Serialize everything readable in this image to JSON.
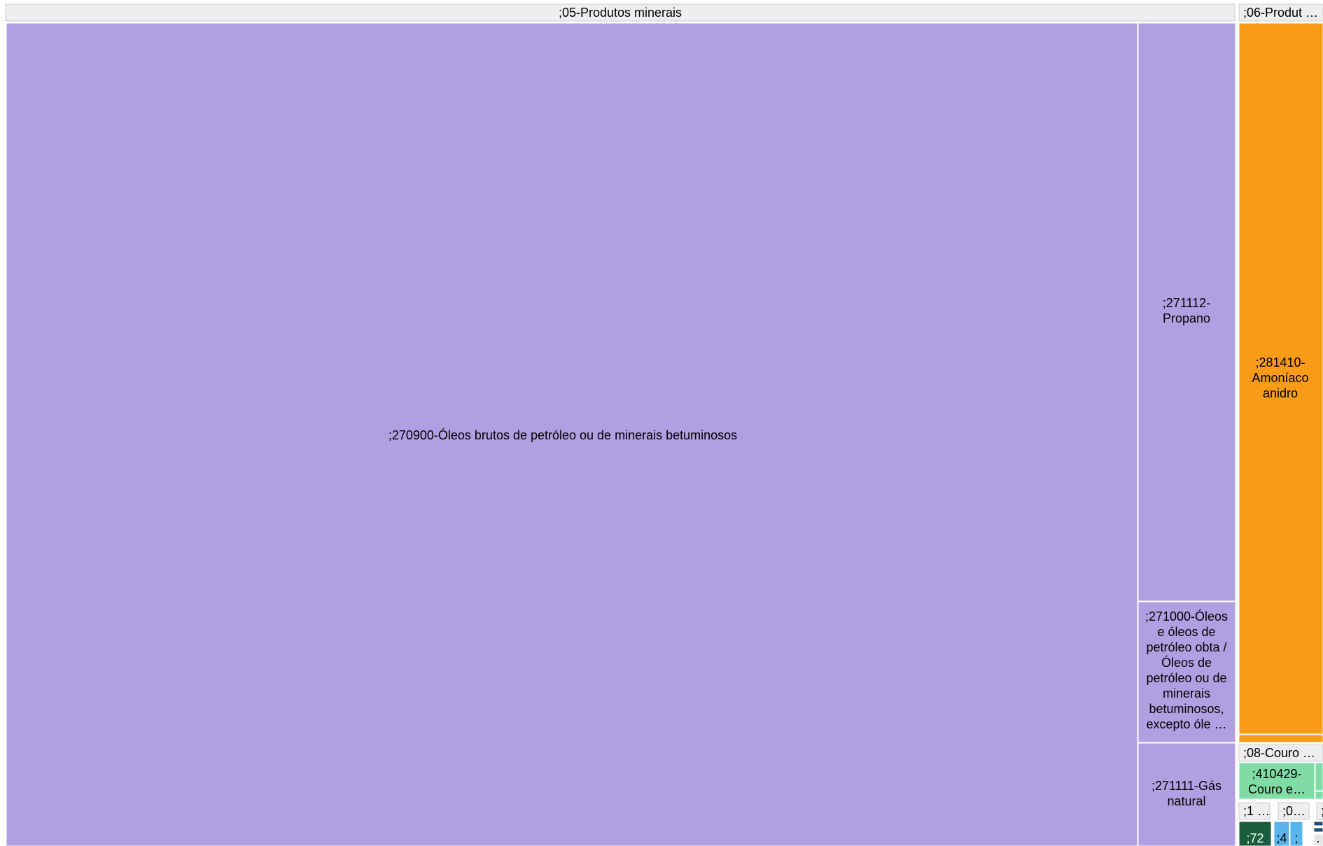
{
  "chart_data": {
    "type": "treemap",
    "groups": [
      {
        "label": ";05-Produtos minerais",
        "items": [
          {
            "label": ";270900-Óleos brutos de petróleo ou de minerais betuminosos",
            "color": "#b0a0e1"
          },
          {
            "label": ";271112-Propano",
            "color": "#b0a0e1"
          },
          {
            "label": ";271000-Óleos e óleos de petróleo obta / Óleos de petróleo ou de minerais betuminosos, excepto óle …",
            "color": "#b0a0e1"
          },
          {
            "label": ";271111-Gás natural",
            "color": "#b0a0e1"
          }
        ]
      },
      {
        "label": ";06-Produt …",
        "items": [
          {
            "label": ";281410-Amoníaco anidro",
            "color": "#f89c18"
          },
          {
            "label": "",
            "color": "#f89c18"
          }
        ]
      },
      {
        "label": ";08-Couro …",
        "items": [
          {
            "label": ";410429-Couro e…",
            "color": "#80dca4"
          },
          {
            "label": "",
            "color": "#80dca4"
          },
          {
            "label": "",
            "color": "#80dca4"
          }
        ]
      },
      {
        "label": ";1 …",
        "items": []
      },
      {
        "label": ";0…",
        "items": []
      },
      {
        "label": ";",
        "items": []
      },
      {
        "label": "",
        "items": [
          {
            "label": ";72",
            "color": "#1a5c3c"
          }
        ]
      },
      {
        "label": "",
        "items": [
          {
            "label": ";4",
            "color": "#5ab4ec"
          },
          {
            "label": ";",
            "color": "#5ab4ec"
          }
        ]
      },
      {
        "label": "",
        "items": [
          {
            "label": "",
            "color": "#1f4f6b"
          },
          {
            "label": "",
            "color": "#1f4f6b"
          },
          {
            "label": ";",
            "color": "#e6e6e6"
          }
        ]
      }
    ]
  }
}
